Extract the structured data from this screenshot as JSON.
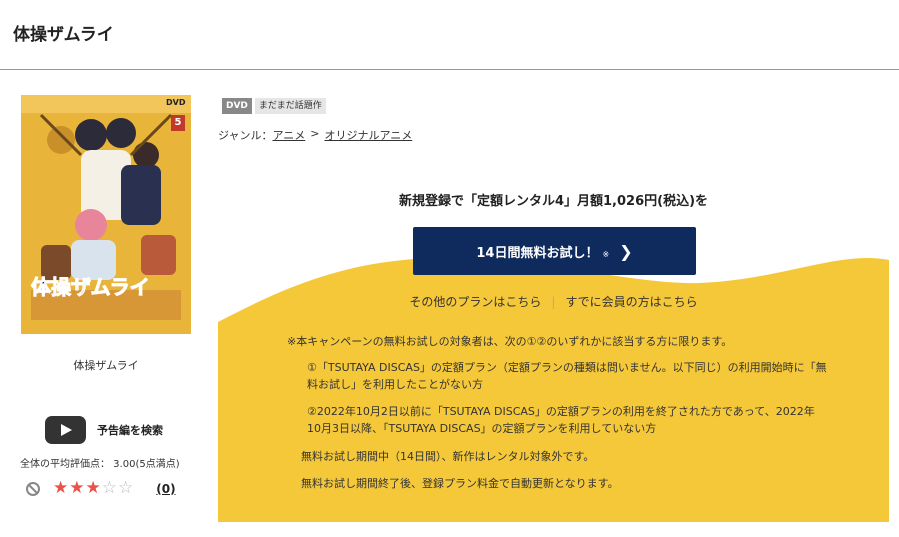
{
  "header": {
    "title": "体操ザムライ"
  },
  "product": {
    "cover_title": "体操ザムライ",
    "cover_art_text": "体操ザムライ",
    "cover_volume": "5",
    "cover_format": "DVD",
    "trailer_label": "予告編を検索",
    "rating_text": "全体の平均評価点： 3.00(5点満点)",
    "rating_value": 3,
    "rating_max": 5,
    "review_count": "(0)"
  },
  "tags": {
    "dvd": "DVD",
    "buzz": "まだまだ話題作"
  },
  "genre": {
    "label": "ジャンル：",
    "level1": "アニメ",
    "separator": ">",
    "level2": "オリジナルアニメ"
  },
  "promo": {
    "headline": "新規登録で「定額レンタル4」月額1,026円(税込)を",
    "cta_label": "14日間無料お試し！",
    "cta_note": "※",
    "cta_chevron": "❯",
    "other_plans": "その他のプランはこちら",
    "divider": "|",
    "member_link": "すでに会員の方はこちら",
    "accent_color": "#f5c83a",
    "cta_color": "#0f2a5c"
  },
  "notes": {
    "n0": "※本キャンペーンの無料お試しの対象者は、次の①②のいずれかに該当する方に限ります。",
    "n1": "①「TSUTAYA DISCAS」の定額プラン（定額プランの種類は問いません。以下同じ）の利用開始時に「無料お試し」を利用したことがない方",
    "n2": "②2022年10月2日以前に「TSUTAYA DISCAS」の定額プランの利用を終了された方であって、2022年10月3日以降、「TSUTAYA DISCAS」の定額プランを利用していない方",
    "n3": "無料お試し期間中（14日間）、新作はレンタル対象外です。",
    "n4": "無料お試し期間終了後、登録プラン料金で自動更新となります。"
  }
}
